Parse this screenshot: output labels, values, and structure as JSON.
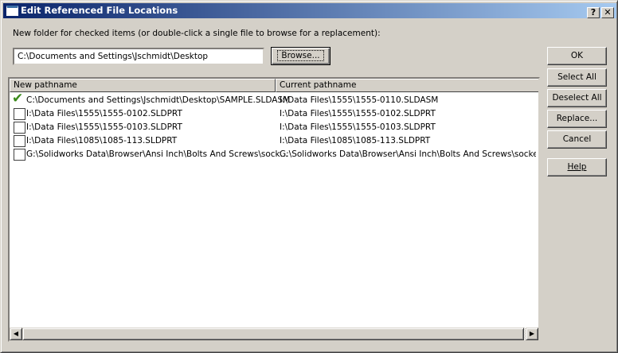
{
  "window": {
    "title": "Edit Referenced File Locations",
    "help_glyph": "?",
    "close_glyph": "✕"
  },
  "instruction": "New folder for checked items (or double-click a single file to browse for a replacement):",
  "folder_input": {
    "value": "C:\\Documents and Settings\\Jschmidt\\Desktop"
  },
  "browse_label": "Browse...",
  "buttons": {
    "ok": "OK",
    "select_all": "Select All",
    "deselect_all": "Deselect All",
    "replace": "Replace...",
    "cancel": "Cancel",
    "help": "Help"
  },
  "columns": [
    "New pathname",
    "Current pathname"
  ],
  "rows": [
    {
      "checked": true,
      "new": "C:\\Documents and Settings\\Jschmidt\\Desktop\\SAMPLE.SLDASM",
      "current": "I:\\Data Files\\1555\\1555-0110.SLDASM"
    },
    {
      "checked": false,
      "new": "I:\\Data Files\\1555\\1555-0102.SLDPRT",
      "current": "I:\\Data Files\\1555\\1555-0102.SLDPRT"
    },
    {
      "checked": false,
      "new": "I:\\Data Files\\1555\\1555-0103.SLDPRT",
      "current": "I:\\Data Files\\1555\\1555-0103.SLDPRT"
    },
    {
      "checked": false,
      "new": "I:\\Data Files\\1085\\1085-113.SLDPRT",
      "current": "I:\\Data Files\\1085\\1085-113.SLDPRT"
    },
    {
      "checked": false,
      "new": "G:\\Solidworks Data\\Browser\\Ansi Inch\\Bolts And Screws\\sock...",
      "current": "G:\\Solidworks Data\\Browser\\Ansi Inch\\Bolts And Screws\\socket ..."
    }
  ],
  "colors": {
    "title_start": "#0a246a",
    "title_end": "#a6caf0",
    "check": "#3a8a1a"
  }
}
